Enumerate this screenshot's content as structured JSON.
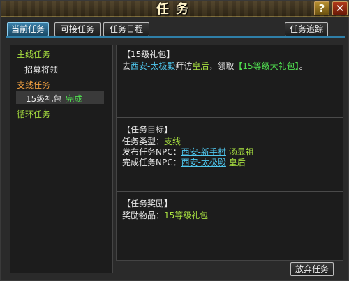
{
  "window": {
    "title": "任务",
    "help_label": "?",
    "close_label": "✕"
  },
  "tabs": [
    {
      "label": "当前任务",
      "active": true
    },
    {
      "label": "可接任务",
      "active": false
    },
    {
      "label": "任务日程",
      "active": false
    }
  ],
  "track_button": "任务追踪",
  "quest_tree": {
    "main_category": "主线任务",
    "main_item": "招募将领",
    "side_category": "支线任务",
    "side_item": {
      "label": "15级礼包",
      "status": "完成"
    },
    "loop_category": "循环任务"
  },
  "detail": {
    "header": "【15级礼包】",
    "desc_prefix": "去",
    "desc_link": "西安-太极殿",
    "desc_mid1": "拜访",
    "desc_npc": "皇后",
    "desc_mid2": "，领取",
    "desc_reward": "【15等级大礼包】",
    "desc_end": "。",
    "goal_header": "【任务目标】",
    "type_label": "任务类型：",
    "type_value": "支线",
    "publish_label": "发布任务NPC：",
    "publish_link": "西安-新手村",
    "publish_npc": "汤显祖",
    "complete_label": "完成任务NPC：",
    "complete_link": "西安-太极殿",
    "complete_npc": "皇后",
    "reward_header": "【任务奖励】",
    "reward_label": "奖励物品：",
    "reward_value": "15等级礼包"
  },
  "abandon_button": "放弃任务",
  "colors": {
    "tab_active": "#2f7fa8",
    "link": "#4fc8f0",
    "category_main": "#a8e040",
    "category_side": "#f0a040",
    "status_done": "#50e050"
  }
}
